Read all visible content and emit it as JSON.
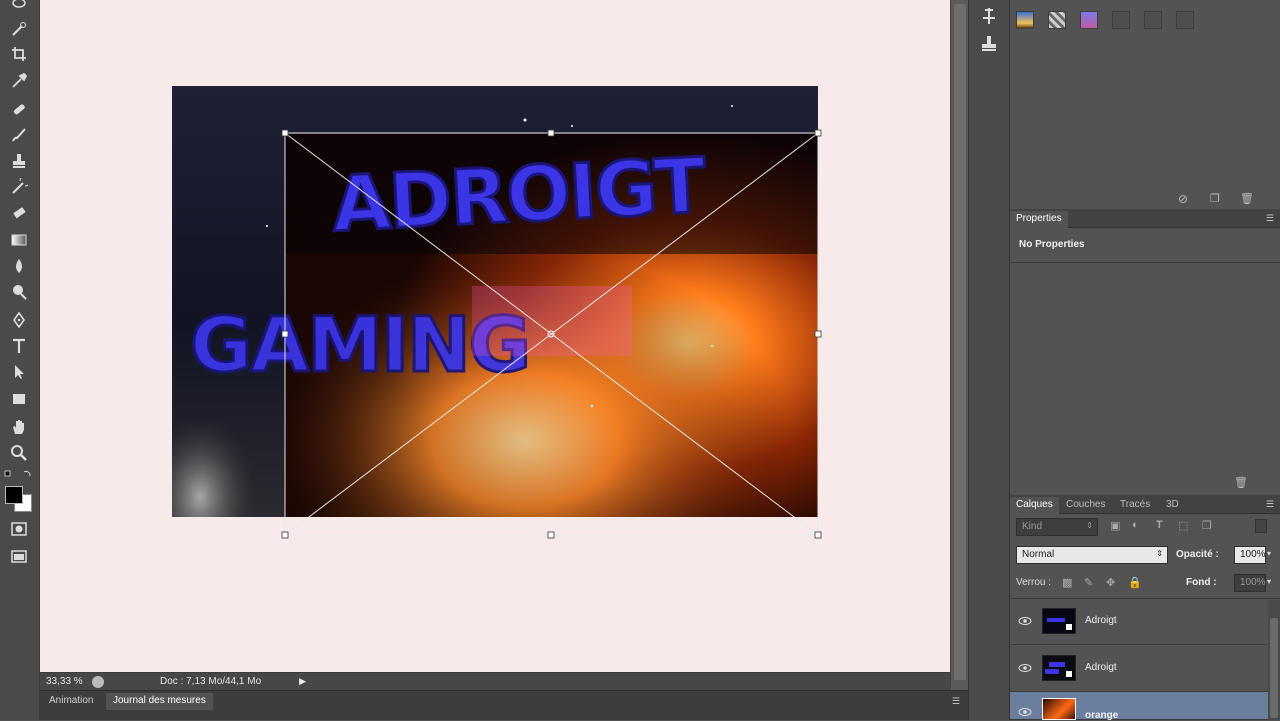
{
  "status": {
    "zoom": "33,33 %",
    "doc": "Doc : 7,13 Mo/44,1 Mo"
  },
  "bottom_tabs": [
    {
      "label": "Animation"
    },
    {
      "label": "Journal des mesures"
    }
  ],
  "artwork": {
    "line1": "ADROIGT",
    "line2": "GAMING"
  },
  "properties": {
    "tab": "Properties",
    "message": "No Properties"
  },
  "layers_panel": {
    "tabs": [
      "Calques",
      "Couches",
      "Tracés",
      "3D"
    ],
    "kind_placeholder": "Kind",
    "blend_mode": "Normal",
    "opacity_label": "Opacité :",
    "opacity_value": "100%",
    "lock_label": "Verrou :",
    "fill_label": "Fond :",
    "fill_value": "100%",
    "layers": [
      {
        "name": "Adroigt",
        "visible": true,
        "selected": false
      },
      {
        "name": "Adroigt",
        "visible": true,
        "selected": false
      },
      {
        "name": "orange",
        "visible": true,
        "selected": true
      }
    ]
  },
  "colors": {
    "canvas_bg": "#f8eaea",
    "text_blue": "#3b35e6",
    "selection": "#6b7e9e"
  }
}
